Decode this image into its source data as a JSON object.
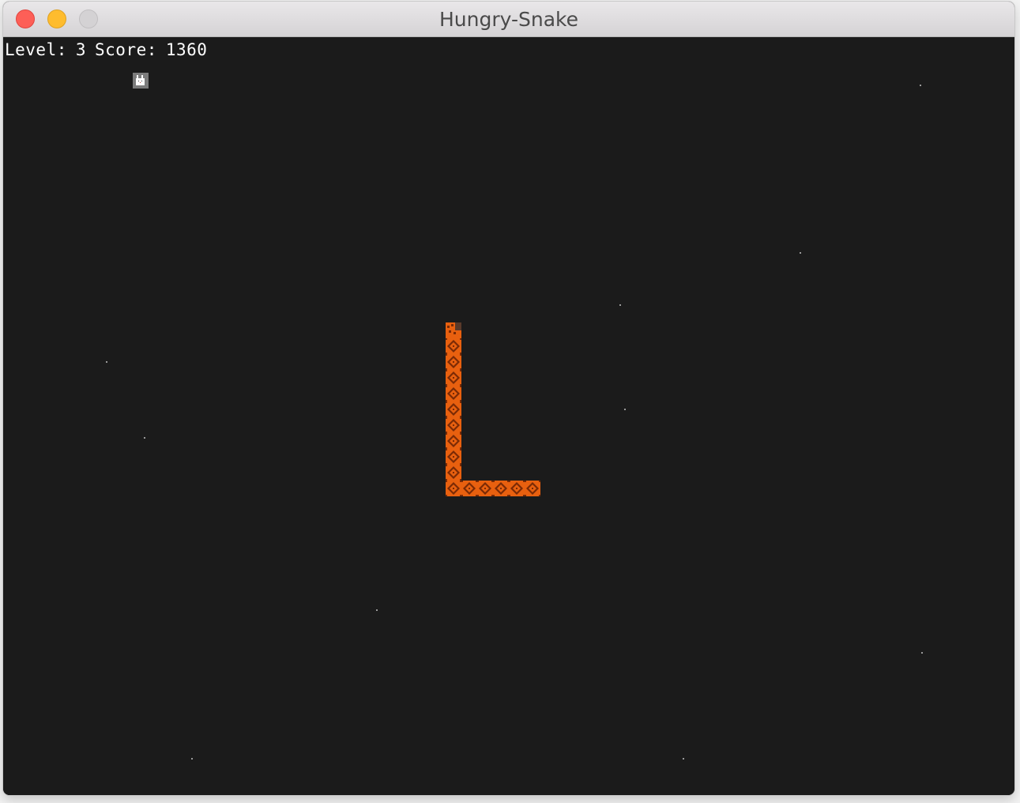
{
  "window": {
    "title": "Hungry-Snake",
    "buttons": [
      "close",
      "minimize",
      "zoom"
    ]
  },
  "hud": {
    "level_label": "Level:",
    "level": "3",
    "score_label": "Score:",
    "score": "1360"
  },
  "game": {
    "snake_direction": "up",
    "snake_body_color": "#e8600f",
    "snake_pattern_color": "#7a2a05",
    "background_color": "#1b1b1b",
    "food_icon": "rabbit-icon",
    "snake_length": 16
  }
}
